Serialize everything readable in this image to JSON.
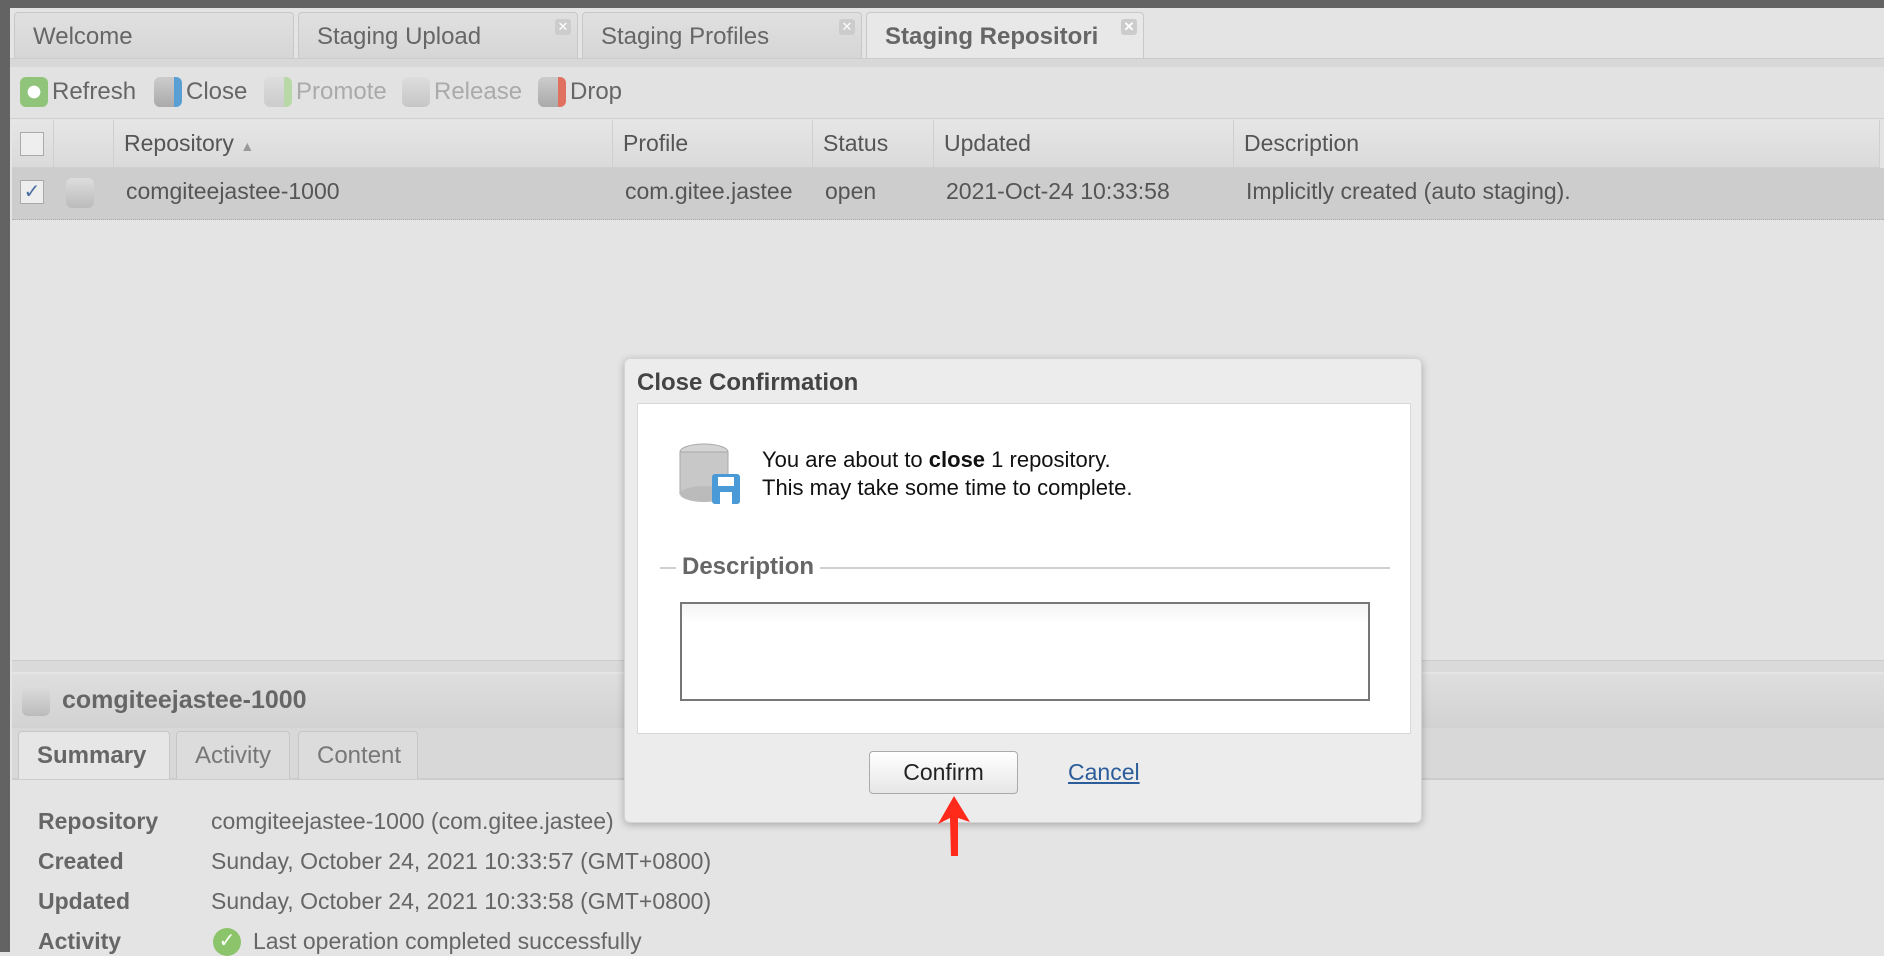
{
  "tabs": [
    {
      "label": "Welcome",
      "closable": false
    },
    {
      "label": "Staging Upload",
      "closable": true
    },
    {
      "label": "Staging Profiles",
      "closable": true
    },
    {
      "label": "Staging Repositori",
      "closable": true,
      "active": true
    }
  ],
  "toolbar": {
    "refresh": "Refresh",
    "close": "Close",
    "promote": "Promote",
    "release": "Release",
    "drop": "Drop"
  },
  "grid": {
    "columns": [
      "Repository",
      "Profile",
      "Status",
      "Updated",
      "Description"
    ],
    "sort_indicator": "▲",
    "rows": [
      {
        "checked": true,
        "repository": "comgiteejastee-1000",
        "profile": "com.gitee.jastee",
        "status": "open",
        "updated": "2021-Oct-24 10:33:58",
        "description": "Implicitly created (auto staging)."
      }
    ]
  },
  "detail": {
    "title": "comgiteejastee-1000",
    "tabs": [
      "Summary",
      "Activity",
      "Content"
    ],
    "fields": [
      {
        "label": "Repository",
        "value": "comgiteejastee-1000 (com.gitee.jastee)"
      },
      {
        "label": "Created",
        "value": "Sunday, October 24, 2021 10:33:57 (GMT+0800)"
      },
      {
        "label": "Updated",
        "value": "Sunday, October 24, 2021 10:33:58 (GMT+0800)"
      },
      {
        "label": "Activity",
        "value": "Last operation completed successfully"
      }
    ]
  },
  "dialog": {
    "title": "Close Confirmation",
    "msg_pre": "You are about to ",
    "msg_bold": "close",
    "msg_post": " 1 repository.",
    "msg_line2": "This may take some time to complete.",
    "legend": "Description",
    "description_value": "",
    "confirm": "Confirm",
    "cancel": "Cancel"
  },
  "colors": {
    "annotation_arrow": "#ff2a1a",
    "link": "#2a5d9a"
  }
}
